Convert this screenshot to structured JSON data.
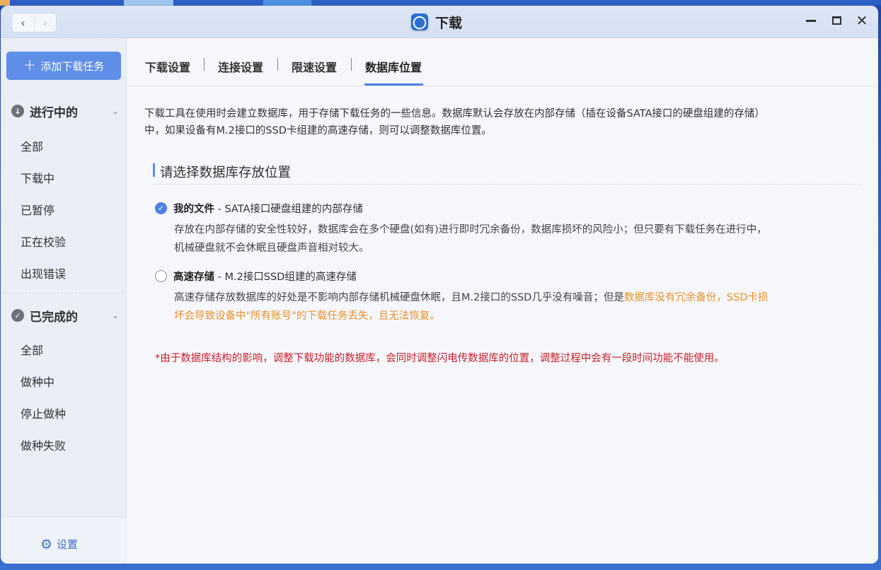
{
  "window": {
    "title": "下载",
    "accent_color": "#5f8ee6"
  },
  "sidebar": {
    "add_task_label": "添加下载任务",
    "in_progress": {
      "label": "进行中的",
      "items": [
        "全部",
        "下载中",
        "已暂停",
        "正在校验",
        "出现错误"
      ]
    },
    "completed": {
      "label": "已完成的",
      "items": [
        "全部",
        "做种中",
        "停止做种",
        "做种失败"
      ]
    },
    "settings_label": "设置"
  },
  "tabs": [
    {
      "label": "下载设置",
      "active": false
    },
    {
      "label": "连接设置",
      "active": false
    },
    {
      "label": "限速设置",
      "active": false
    },
    {
      "label": "数据库位置",
      "active": true
    }
  ],
  "content": {
    "description_line1": "下载工具在使用时会建立数据库，用于存储下载任务的一些信息。数据库默认会存放在内部存储（插在设备SATA接口的硬盘组建的存储）",
    "description_line2": "中，如果设备有M.2接口的SSD卡组建的高速存储，则可以调整数据库位置。",
    "section_title": "请选择数据库存放位置",
    "options": [
      {
        "name": "我的文件",
        "subtitle": " - SATA接口硬盘组建的内部存储",
        "selected": true,
        "detail_line1": "存放在内部存储的安全性较好，数据库会在多个硬盘(如有)进行即时冗余备份，数据库损坏的风险小；但只要有下载任务在进行中，",
        "detail_line2": "机械硬盘就不会休眠且硬盘声音相对较大。"
      },
      {
        "name": "高速存储",
        "subtitle": " - M.2接口SSD组建的高速存储",
        "selected": false,
        "detail_plain": "高速存储存放数据库的好处是不影响内部存储机械硬盘休眠，且M.2接口的SSD几乎没有噪音；但是",
        "detail_warn_line1": "数据库没有冗余备份，SSD卡损",
        "detail_warn_line2": "坏会导致设备中\"所有账号\"的下载任务丢失，且无法恢复。"
      }
    ],
    "note": "*由于数据库结构的影响，调整下载功能的数据库，会同时调整闪电传数据库的位置，调整过程中会有一段时间功能不能使用。",
    "warning_color": "#e8912c",
    "note_color": "#c91f2a"
  }
}
